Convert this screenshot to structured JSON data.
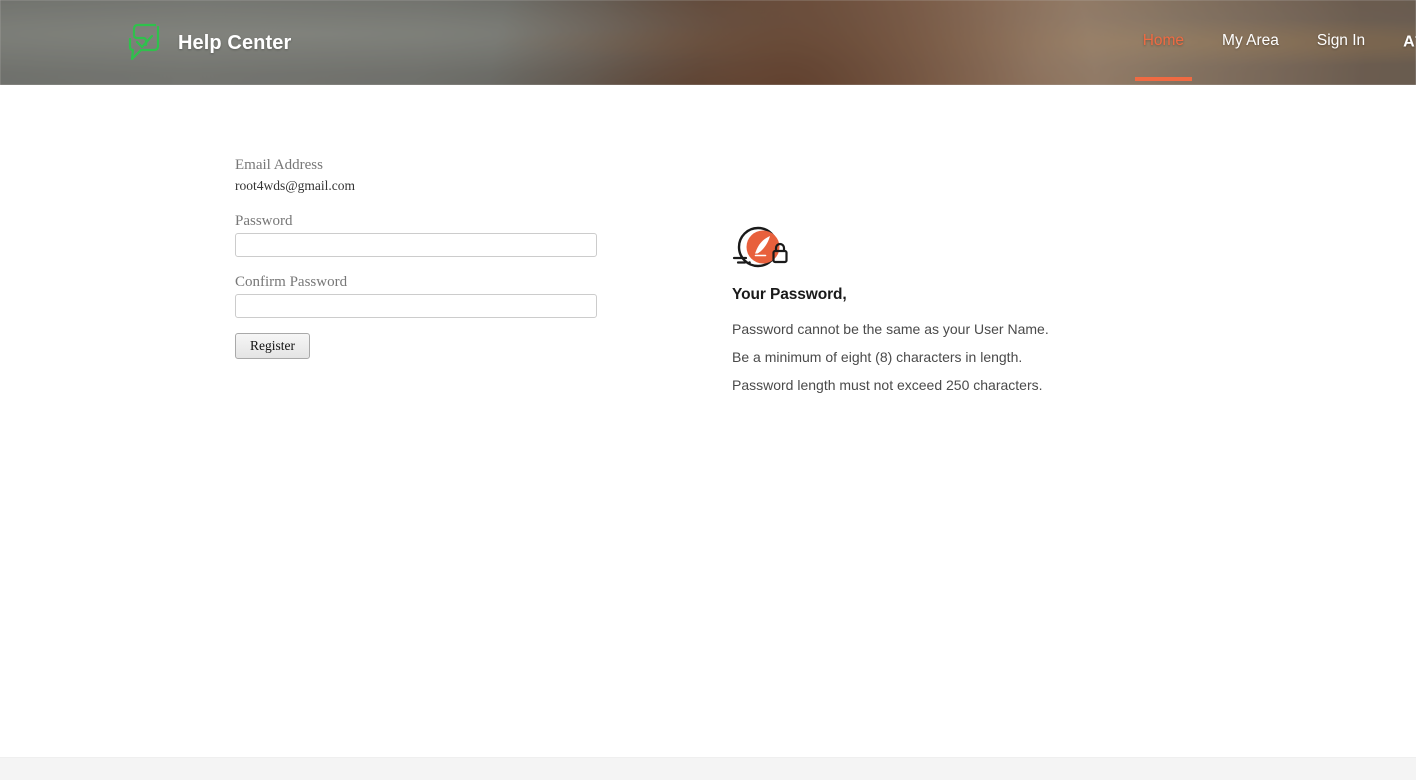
{
  "header": {
    "brand": {
      "logo_icon": "speech-bubble-check-icon",
      "logo_color": "#2fc14c",
      "title": "Help Center"
    },
    "nav": [
      {
        "label": "Home",
        "active": true,
        "icon": null
      },
      {
        "label": "My Area",
        "active": false,
        "icon": null
      },
      {
        "label": "Sign In",
        "active": false,
        "icon": null
      }
    ],
    "text_size_control": {
      "letter": "A",
      "modifier": "+",
      "icon": "increase-text-size-icon"
    },
    "accent_color": "#ef6a42"
  },
  "form": {
    "email_label": "Email Address",
    "email_value": "root4wds@gmail.com",
    "password_label": "Password",
    "password_value": "",
    "password_placeholder": "",
    "confirm_password_label": "Confirm Password",
    "confirm_password_value": "",
    "confirm_password_placeholder": "",
    "submit_label": "Register"
  },
  "password_info": {
    "icon": "password-quill-lock-icon",
    "icon_color": "#e8603c",
    "heading": "Your Password,",
    "rules": [
      "Password cannot be the same as your User Name.",
      "Be a minimum of eight (8) characters in length.",
      "Password length must not exceed 250 characters."
    ]
  },
  "footer": {
    "background_color": "#f4f4f4"
  }
}
